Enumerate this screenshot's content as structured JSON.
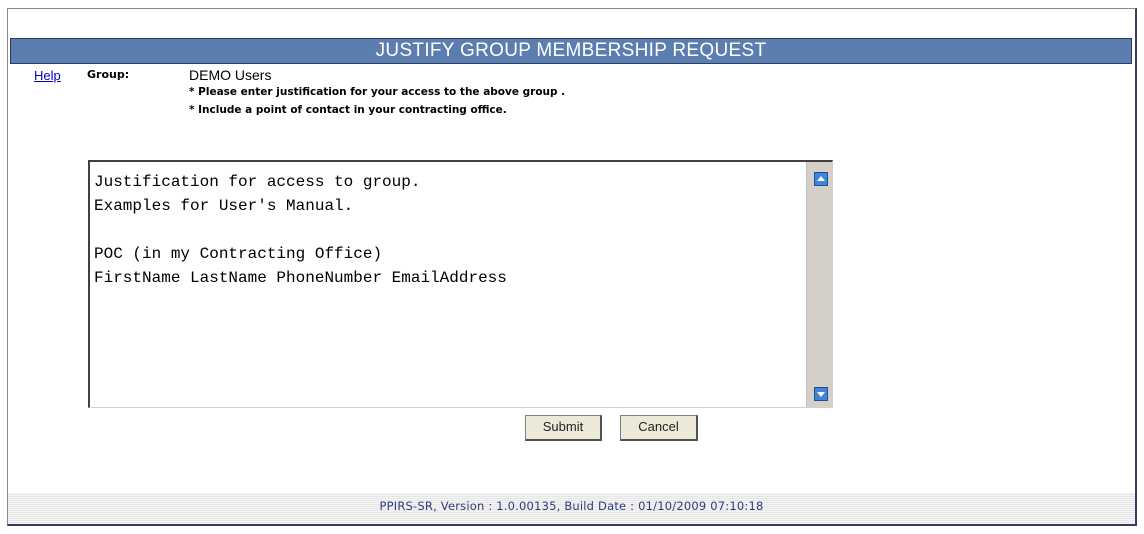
{
  "header": {
    "title": "JUSTIFY GROUP MEMBERSHIP REQUEST",
    "help_label": "Help"
  },
  "group": {
    "label": "Group:",
    "value": "DEMO Users"
  },
  "instructions": [
    "* Please enter justification for your access to the above group .",
    "* Include a point of contact in your contracting office."
  ],
  "justification": {
    "value": "Justification for access to group.\nExamples for User's Manual.\n\nPOC (in my Contracting Office)\nFirstName LastName PhoneNumber EmailAddress"
  },
  "buttons": {
    "submit_label": "Submit",
    "cancel_label": "Cancel"
  },
  "footer": {
    "text": "PPIRS-SR, Version : 1.0.00135, Build Date : 01/10/2009 07:10:18"
  },
  "icons": {
    "scroll_up": "scroll-up-arrow-icon",
    "scroll_down": "scroll-down-arrow-icon"
  },
  "colors": {
    "title_bar": "#5b7db0",
    "link": "#0000cc",
    "footer_text": "#2f3c78",
    "scroll_button": "#3f86d8"
  }
}
